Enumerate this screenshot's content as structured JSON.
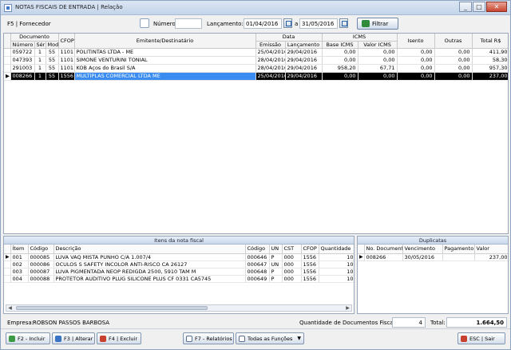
{
  "window": {
    "title": "NOTAS FISCAIS DE ENTRADA | Relação",
    "min": "_",
    "max": "□",
    "close": "✕"
  },
  "toolbar": {
    "filter_label": "F5 | Fornecedor",
    "numero_label": "Número:",
    "numero_value": "",
    "lancamento_label": "Lançamento:",
    "date_from": "01/04/2016",
    "date_sep": "a",
    "date_to": "31/05/2016",
    "filtrar_label": "Filtrar",
    "colors": {
      "accent": "#3a8cf0",
      "selected_row": "#000000"
    }
  },
  "main_table": {
    "group_headers": {
      "documento": "Documento",
      "data": "Data",
      "icms": "ICMS"
    },
    "headers": {
      "numero": "Número",
      "serie": "Sér",
      "mod": "Mod",
      "cfop": "CFOP",
      "emitente": "Emitente/Destinatário",
      "emissao": "Emissão",
      "lancamento": "Lançamento",
      "base_icms": "Base ICMS",
      "valor_icms": "Valor ICMS",
      "isento": "Isento",
      "outras": "Outras",
      "total": "Total R$"
    },
    "rows": [
      {
        "numero": "059722",
        "serie": "1",
        "mod": "55",
        "cfop": "1101",
        "emitente": "POLITINTAS LTDA - ME",
        "emissao": "25/04/2016",
        "lancamento": "29/04/2016",
        "base_icms": "0,00",
        "valor_icms": "0,00",
        "isento": "0,00",
        "outras": "0,00",
        "total": "411,90"
      },
      {
        "numero": "047393",
        "serie": "1",
        "mod": "55",
        "cfop": "1101",
        "emitente": "SIMONE VENTURINI TONIAL",
        "emissao": "28/04/2016",
        "lancamento": "29/04/2016",
        "base_icms": "0,00",
        "valor_icms": "0,00",
        "isento": "0,00",
        "outras": "0,00",
        "total": "58,30"
      },
      {
        "numero": "291003",
        "serie": "1",
        "mod": "55",
        "cfop": "1101",
        "emitente": "KOB Aços do Brasil S/A",
        "emissao": "28/04/2016",
        "lancamento": "29/04/2016",
        "base_icms": "958,20",
        "valor_icms": "67,71",
        "isento": "0,00",
        "outras": "0,00",
        "total": "957,30"
      },
      {
        "numero": "008266",
        "serie": "1",
        "mod": "55",
        "cfop": "1556",
        "emitente": "MULTIPLAS COMERCIAL LTDA ME",
        "emissao": "25/04/2016",
        "lancamento": "29/04/2016",
        "base_icms": "0,00",
        "valor_icms": "0,00",
        "isento": "0,00",
        "outras": "0,00",
        "total": "237,00",
        "selected": true
      }
    ]
  },
  "itens_panel": {
    "title": "Itens da nota fiscal",
    "headers": {
      "item": "Ítem",
      "codigo": "Código",
      "descricao": "Descrição",
      "codigo2": "Código",
      "un": "UN",
      "cst": "CST",
      "cfop": "CFOP",
      "quantidade": "Quantidade"
    },
    "rows": [
      {
        "item": "001",
        "codigo": "000085",
        "descricao": "LUVA VAQ MISTA PUNHO C/A 1.007/4",
        "codigo2": "000646",
        "un": "P",
        "cst": "000",
        "cfop": "1556",
        "quantidade": "10"
      },
      {
        "item": "002",
        "codigo": "000086",
        "descricao": "OCULOS S SAFETY INCOLOR ANTI-RISCO CA 26127",
        "codigo2": "000647",
        "un": "UN",
        "cst": "000",
        "cfop": "1556",
        "quantidade": "10"
      },
      {
        "item": "003",
        "codigo": "000087",
        "descricao": "LUVA PIGMENTADA NEOP REDIGDA 2500, 5910 TAM M",
        "codigo2": "000648",
        "un": "P",
        "cst": "000",
        "cfop": "1556",
        "quantidade": "10"
      },
      {
        "item": "004",
        "codigo": "000088",
        "descricao": "PROTETOR AUDITIVO PLUG SILICONE PLUS CF 0331 CA5745",
        "codigo2": "000649",
        "un": "P",
        "cst": "000",
        "cfop": "1556",
        "quantidade": "10"
      }
    ]
  },
  "duplicatas_panel": {
    "title": "Duplicatas",
    "headers": {
      "numero": "No. Documento",
      "vencimento": "Vencimento",
      "pagamento": "Pagamento",
      "valor": "Valor"
    },
    "rows": [
      {
        "numero": "008266",
        "vencimento": "30/05/2016",
        "pagamento": "",
        "valor": "237,00"
      }
    ]
  },
  "status": {
    "empresa_label": "Empresa:",
    "empresa_value": "ROBSON PASSOS BARBOSA",
    "qtd_label": "Quantidade de Documentos Fiscais:",
    "qtd_value": "4",
    "total_label": "Total:",
    "total_value": "1.664,50"
  },
  "bottombar": {
    "incluir": "F2 - Incluir",
    "alterar": "F3 | Alterar",
    "excluir": "F4 | Excluir",
    "relatorios": "F7 - Relatórios",
    "funcoes": "Todas as Funções",
    "sair": "ESC | Sair"
  }
}
